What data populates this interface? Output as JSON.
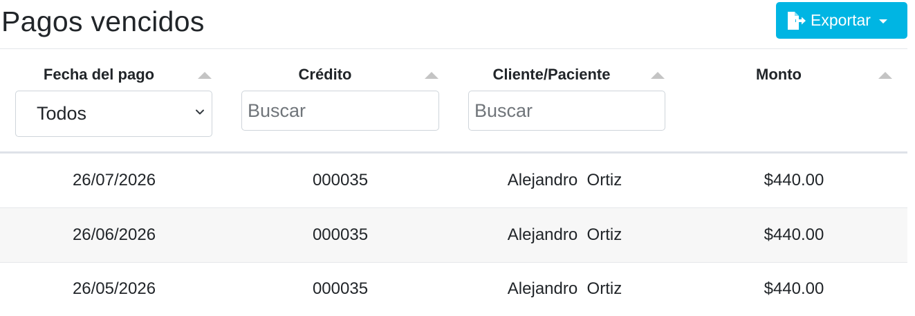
{
  "header": {
    "title": "Pagos vencidos",
    "export_label": "Exportar"
  },
  "table": {
    "columns": [
      {
        "label": "Fecha del pago"
      },
      {
        "label": "Crédito"
      },
      {
        "label": "Cliente/Paciente"
      },
      {
        "label": "Monto"
      }
    ],
    "filters": {
      "fecha_select_value": "Todos",
      "credito_placeholder": "Buscar",
      "cliente_placeholder": "Buscar"
    },
    "rows": [
      {
        "fecha": "26/07/2026",
        "credito": "000035",
        "cliente": "Alejandro  Ortiz",
        "monto": "$440.00"
      },
      {
        "fecha": "26/06/2026",
        "credito": "000035",
        "cliente": "Alejandro  Ortiz",
        "monto": "$440.00"
      },
      {
        "fecha": "26/05/2026",
        "credito": "000035",
        "cliente": "Alejandro  Ortiz",
        "monto": "$440.00"
      }
    ]
  },
  "colors": {
    "accent": "#00b5e3",
    "sort_arrow": "#c4c4c4",
    "stripe": "#f7f7f7"
  },
  "icons": [
    "file-export-icon",
    "caret-down-icon",
    "sort-up-icon",
    "chevron-down-icon"
  ]
}
